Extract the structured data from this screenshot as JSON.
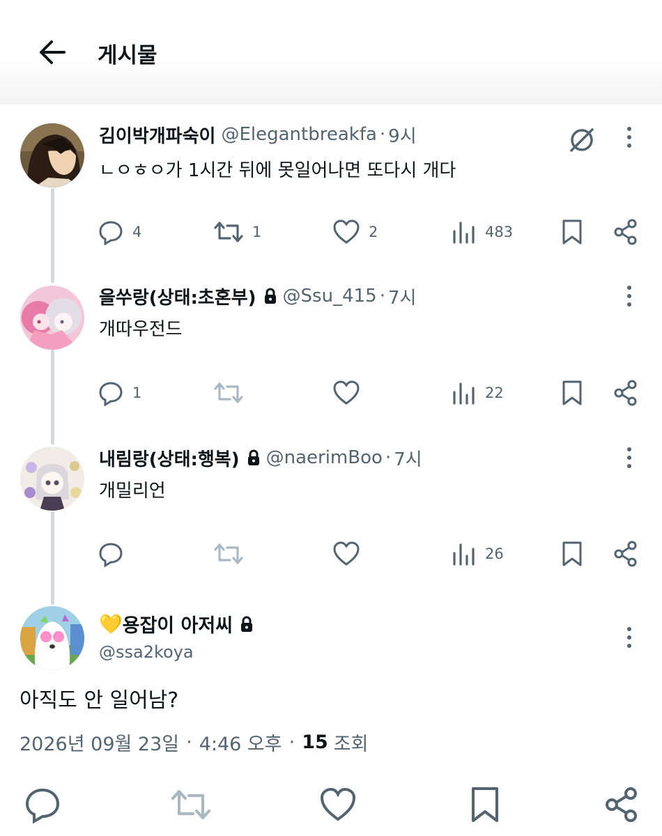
{
  "header": {
    "title": "게시물"
  },
  "replies": [
    {
      "display_name": "김이박개파숙이",
      "handle": "@Elegantbreakfa",
      "time": "9시",
      "text": "ㄴㅇㅎㅇ가 1시간 뒤에 못일어나면  또다시 개다",
      "locked": false,
      "counts": {
        "reply": "4",
        "retweet": "1",
        "like": "2",
        "views": "483"
      }
    },
    {
      "display_name": "을쑤랑(상태:초혼부)",
      "handle": "@Ssu_415",
      "time": "7시",
      "text": "개따우전드",
      "locked": true,
      "counts": {
        "reply": "1",
        "retweet": "",
        "like": "",
        "views": "22"
      }
    },
    {
      "display_name": "내림랑(상태:행복)",
      "handle": "@naerimBoo",
      "time": "7시",
      "text": "개밀리언",
      "locked": true,
      "counts": {
        "reply": "",
        "retweet": "",
        "like": "",
        "views": "26"
      }
    }
  ],
  "main_tweet": {
    "emoji": "💛",
    "display_name": "용잡이 아저씨",
    "handle": "@ssa2koya",
    "text": "아직도 안 일어남?",
    "date": "2026년 09월 23일",
    "time": "4:46 오후",
    "views_count": "15",
    "views_label": "조회"
  },
  "colors": {
    "text": "#0f1419",
    "secondary": "#536471",
    "thread_line": "#cfd9de",
    "retweet_muted": "#aab8c2"
  },
  "icons": [
    "back-arrow-icon",
    "grok-icon",
    "more-icon",
    "reply-icon",
    "retweet-icon",
    "like-icon",
    "views-icon",
    "bookmark-icon",
    "share-icon",
    "lock-icon"
  ]
}
